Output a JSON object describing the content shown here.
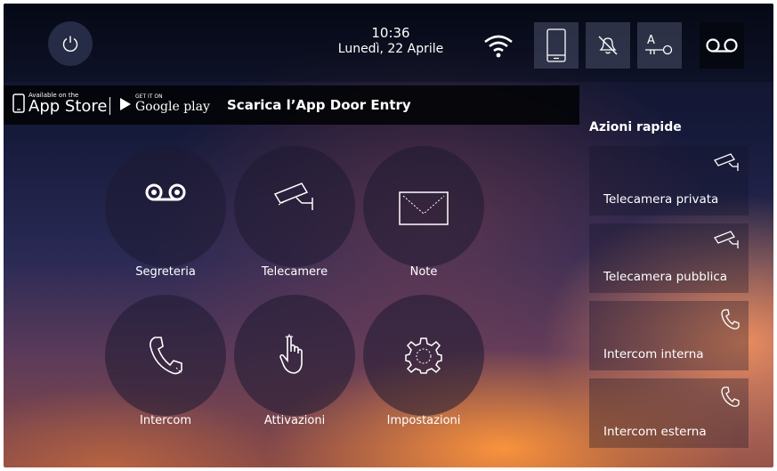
{
  "status_bar": {
    "time": "10:36",
    "date": "Lunedì, 22 Aprile",
    "icons": [
      "power-icon",
      "wifi-icon",
      "smartphone-icon",
      "bell-muted-icon",
      "door-key-icon",
      "voicemail-icon"
    ]
  },
  "store_banner": {
    "apple_small": "Available on the",
    "apple_big": "App Store",
    "google_small": "GET IT ON",
    "google_big": "Google play",
    "text": "Scarica l’App Door Entry"
  },
  "main_menu": [
    {
      "label": "Segreteria",
      "icon": "voicemail-icon"
    },
    {
      "label": "Telecamere",
      "icon": "camera-icon"
    },
    {
      "label": "Note",
      "icon": "envelope-icon"
    },
    {
      "label": "Intercom",
      "icon": "phone-icon"
    },
    {
      "label": "Attivazioni",
      "icon": "hand-pointer-icon"
    },
    {
      "label": "Impostazioni",
      "icon": "gear-icon"
    }
  ],
  "quick_actions": {
    "title": "Azioni rapide",
    "items": [
      {
        "label": "Telecamera privata",
        "icon": "camera-icon"
      },
      {
        "label": "Telecamera pubblica",
        "icon": "camera-icon"
      },
      {
        "label": "Intercom interna",
        "icon": "phone-icon"
      },
      {
        "label": "Intercom esterna",
        "icon": "phone-icon"
      }
    ]
  }
}
